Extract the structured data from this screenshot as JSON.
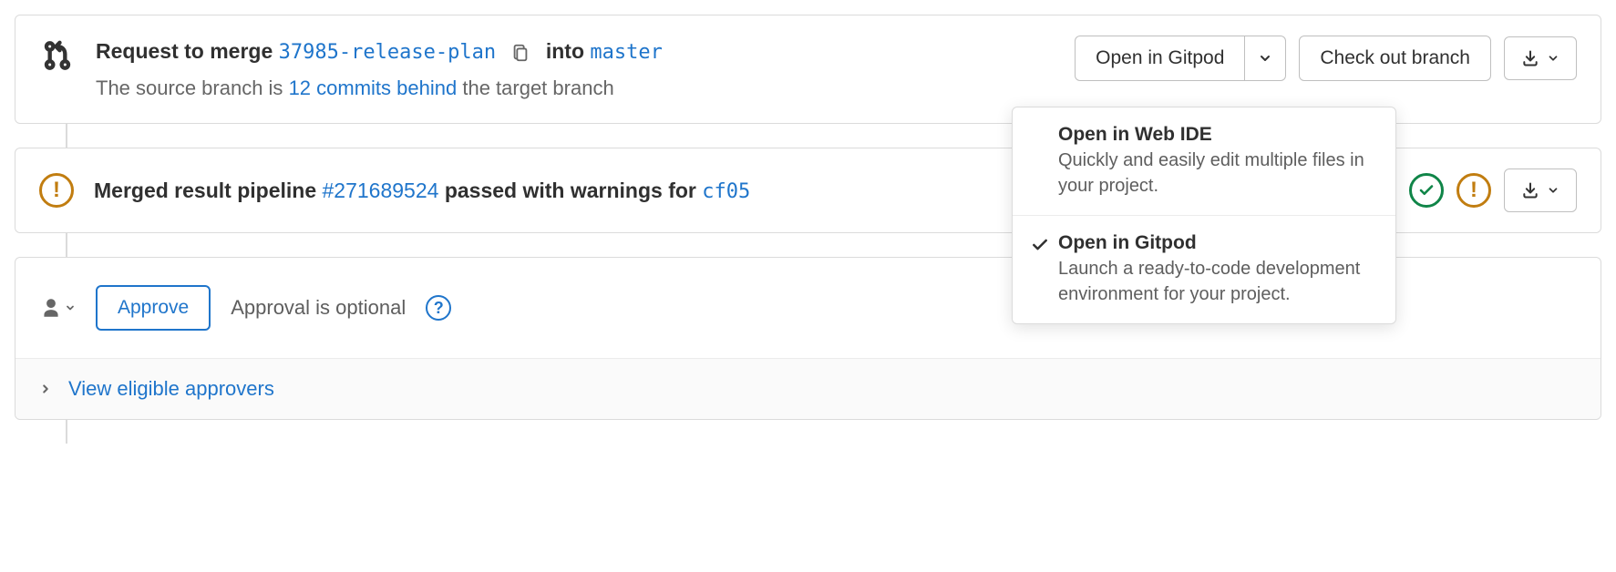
{
  "merge": {
    "request_prefix": "Request to merge",
    "source_branch": "37985-release-plan",
    "into": "into",
    "target_branch": "master",
    "behind_prefix": "The source branch is",
    "behind_link": "12 commits behind",
    "behind_suffix": "the target branch"
  },
  "actions": {
    "open_ide_label": "Open in Gitpod",
    "checkout_label": "Check out branch"
  },
  "dropdown": {
    "items": [
      {
        "title": "Open in Web IDE",
        "desc": "Quickly and easily edit multiple files in your project.",
        "selected": false
      },
      {
        "title": "Open in Gitpod",
        "desc": "Launch a ready-to-code development environment for your project.",
        "selected": true
      }
    ]
  },
  "pipeline": {
    "prefix": "Merged result pipeline",
    "id_link": "#271689524",
    "mid": "passed with warnings for",
    "commit_link": "cf05"
  },
  "approval": {
    "approve_label": "Approve",
    "optional_text": "Approval is optional",
    "eligible_link": "View eligible approvers"
  }
}
